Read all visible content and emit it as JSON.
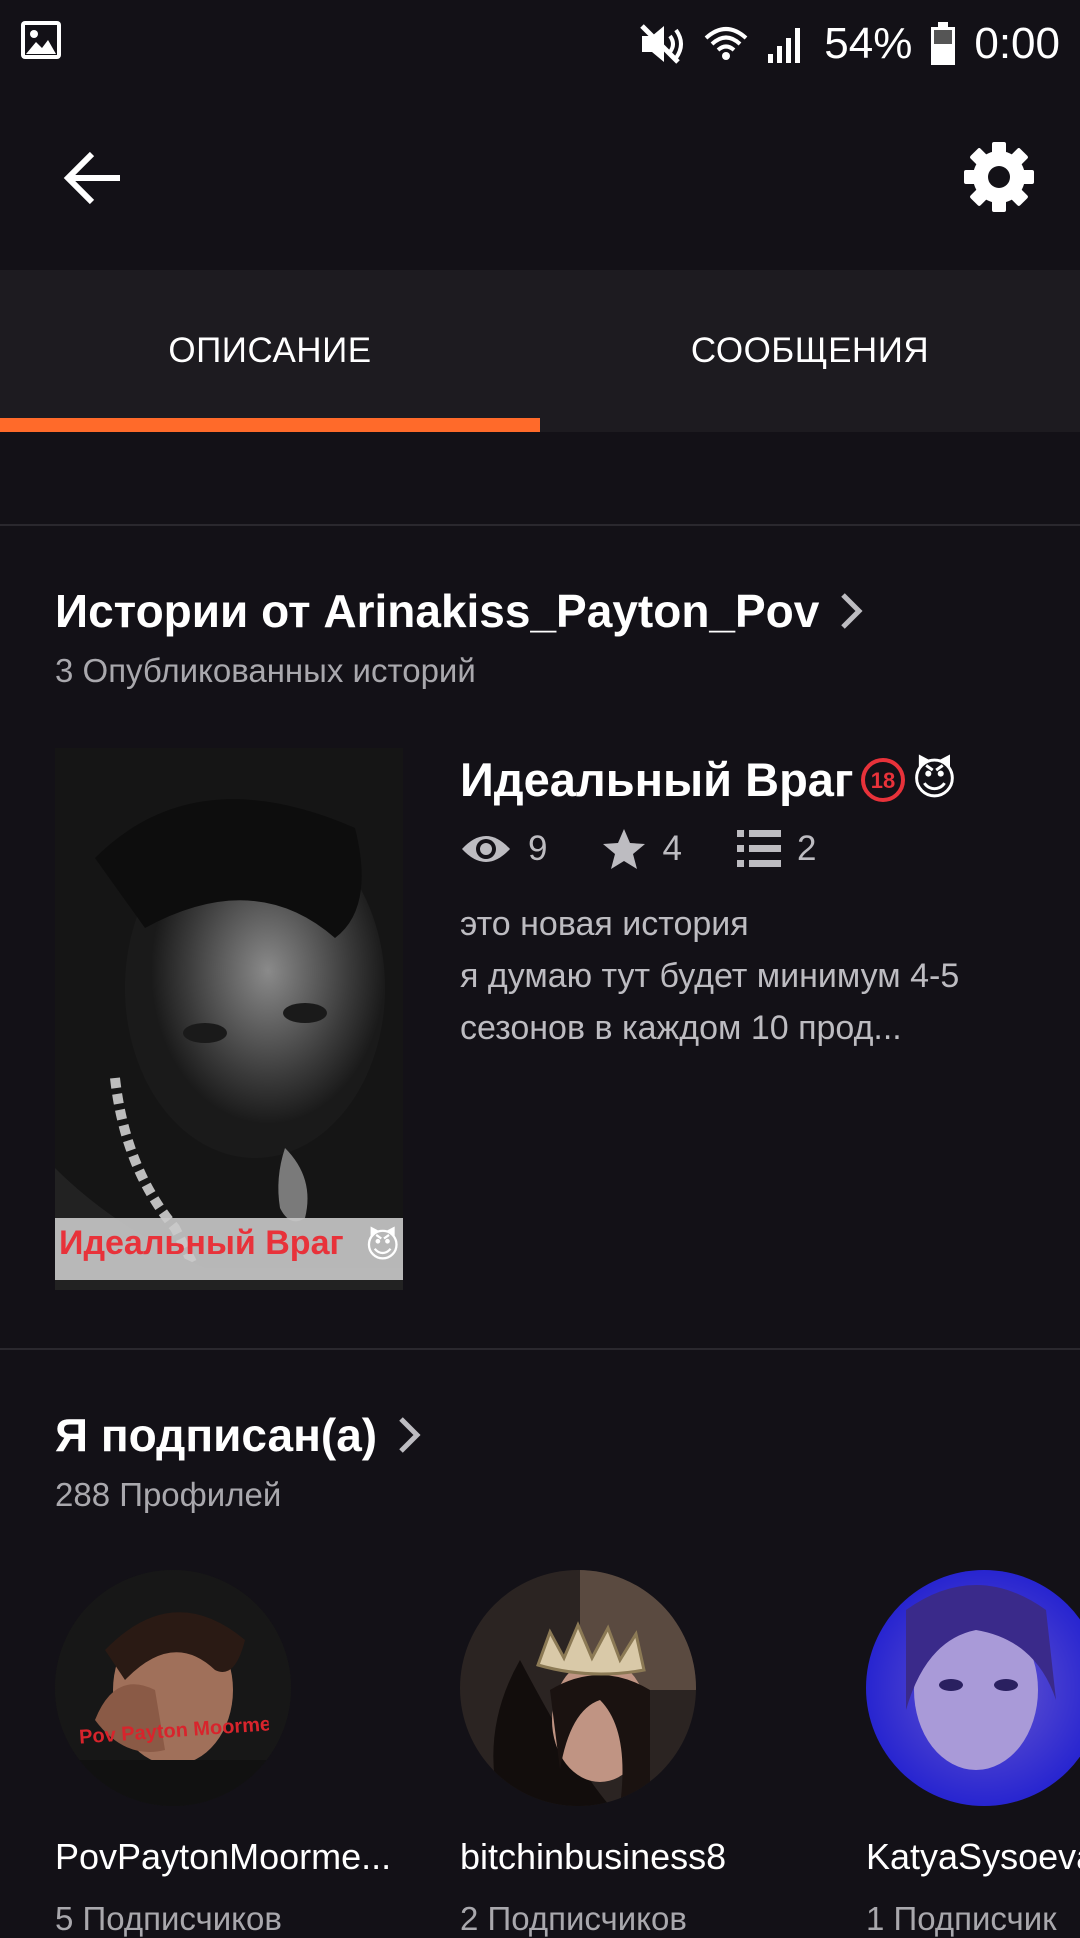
{
  "status_bar": {
    "battery": "54%",
    "time": "0:00",
    "icons": [
      "image-icon",
      "mute-icon",
      "wifi-icon",
      "signal-icon",
      "battery-icon"
    ]
  },
  "app_bar": {
    "back_icon": "arrow-back-icon",
    "settings_icon": "gear-icon"
  },
  "tabs": [
    {
      "label": "ОПИСАНИЕ",
      "active": true
    },
    {
      "label": "СООБЩЕНИЯ",
      "active": false
    }
  ],
  "stories_section": {
    "title": "Истории от Arinakiss_Payton_Pov",
    "subtitle": "3 Опубликованных историй",
    "story": {
      "title": "Идеальный Враг",
      "cover_text": "Идеальный Враг",
      "views": "9",
      "votes": "4",
      "parts": "2",
      "description_lines": [
        "это новая история",
        "я думаю тут будет минимум 4-5",
        "сезонов в каждом 10 прод..."
      ]
    }
  },
  "following_section": {
    "title": "Я подписан(а)",
    "subtitle": "288 Профилей",
    "profiles": [
      {
        "name": "PovPaytonMoorme...",
        "followers": "5 Подписчиков",
        "avatar_text": "Pov Payton Moormeier"
      },
      {
        "name": "bitchinbusiness8",
        "followers": "2 Подписчиков"
      },
      {
        "name": "KatyaSysoeva",
        "followers": "1 Подписчик"
      }
    ]
  },
  "colors": {
    "background": "#131117",
    "tab_bar": "#1d1b20",
    "accent": "#ff6a2a",
    "muted_text": "#a9a8ad"
  }
}
